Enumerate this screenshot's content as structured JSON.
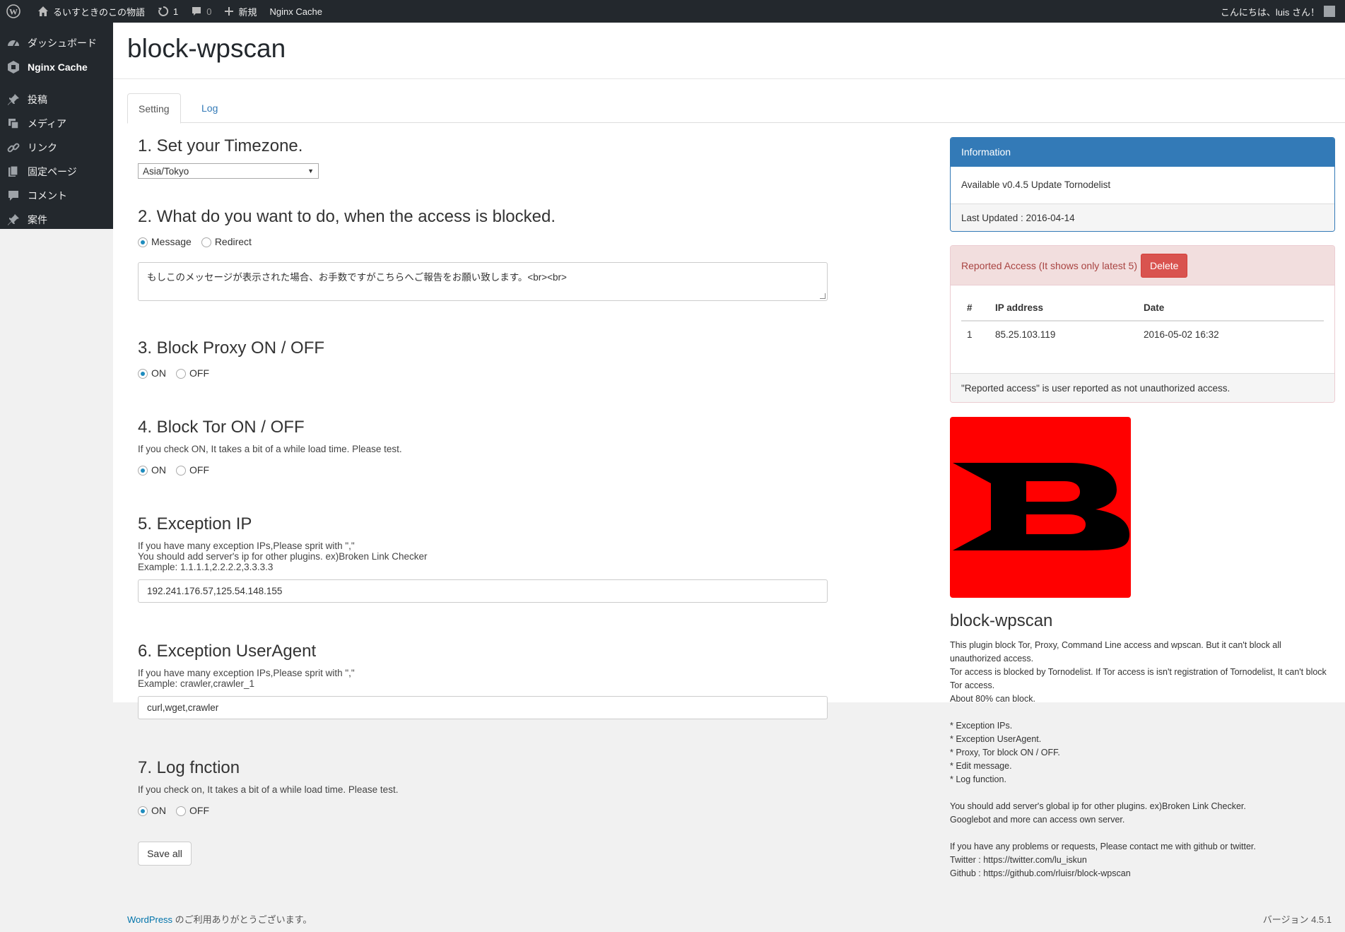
{
  "adminbar": {
    "site_name": "るいすときのこの物語",
    "updates_count": "1",
    "comments_count": "0",
    "new_label": "新規",
    "nginx_label": "Nginx Cache",
    "greeting": "こんにちは、luis さん！"
  },
  "menu": {
    "items": [
      {
        "label": "ダッシュボード",
        "icon": "dashboard-icon"
      },
      {
        "label": "Nginx Cache",
        "icon": "nginx-icon"
      },
      {
        "label": "投稿",
        "icon": "pin-icon"
      },
      {
        "label": "メディア",
        "icon": "media-icon"
      },
      {
        "label": "リンク",
        "icon": "link-icon"
      },
      {
        "label": "固定ページ",
        "icon": "page-icon"
      },
      {
        "label": "コメント",
        "icon": "comment-icon"
      },
      {
        "label": "案件",
        "icon": "pin-icon"
      }
    ]
  },
  "page": {
    "title": "block-wpscan",
    "tabs": [
      "Setting",
      "Log"
    ]
  },
  "form": {
    "s1_title": "1. Set your Timezone.",
    "timezone": "Asia/Tokyo",
    "s2_title": "2. What do you want to do, when the access is blocked.",
    "s2_options": [
      "Message",
      "Redirect"
    ],
    "message_value": "もしこのメッセージが表示された場合、お手数ですがこちらへご報告をお願い致します。<br><br>",
    "s3_title": "3. Block Proxy ON / OFF",
    "on_label": "ON",
    "off_label": "OFF",
    "s4_title": "4. Block Tor ON / OFF",
    "s4_help": "If you check ON, It takes a bit of a while load time. Please test.",
    "s5_title": "5. Exception IP",
    "s5_help1": "If you have many exception IPs,Please sprit with \",\"",
    "s5_help2": "You should add server's ip for other plugins. ex)Broken Link Checker",
    "s5_help3": "Example: 1.1.1.1,2.2.2.2,3.3.3.3",
    "exception_ip": "192.241.176.57,125.54.148.155",
    "s6_title": "6. Exception UserAgent",
    "s6_help1": "If you have many exception IPs,Please sprit with \",\"",
    "s6_help2": "Example: crawler,crawler_1",
    "exception_ua": "curl,wget,crawler",
    "s7_title": "7. Log fnction",
    "s7_help": "If you check on, It takes a bit of a while load time. Please test.",
    "save_label": "Save all"
  },
  "info": {
    "heading": "Information",
    "body": "Available v0.4.5 Update Tornodelist",
    "footer": "Last Updated : 2016-04-14"
  },
  "reported": {
    "heading": "Reported Access (It shows only latest 5)",
    "delete_label": "Delete",
    "columns": [
      "#",
      "IP address",
      "Date"
    ],
    "rows": [
      {
        "num": "1",
        "ip": "85.25.103.119",
        "date": "2016-05-02 16:32"
      }
    ],
    "footer": "\"Reported access\" is user reported as not unauthorized access."
  },
  "about": {
    "title": "block-wpscan",
    "lines": [
      "This plugin block Tor, Proxy, Command Line access and wpscan. But it can't block all unauthorized access.",
      "Tor access is blocked by Tornodelist. If Tor access is isn't registration of Tornodelist, It can't block Tor access.",
      "About 80% can block.",
      "",
      "* Exception IPs.",
      "* Exception UserAgent.",
      "* Proxy, Tor block ON / OFF.",
      "* Edit message.",
      "* Log function.",
      "",
      "You should add server's global ip for other plugins. ex)Broken Link Checker.",
      "Googlebot and more can access own server.",
      "",
      "If you have any problems or requests, Please contact me with github or twitter.",
      "Twitter : https://twitter.com/lu_iskun",
      "Github : https://github.com/rluisr/block-wpscan"
    ]
  },
  "footer": {
    "wp_link": "WordPress",
    "thanks": " のご利用ありがとうございます。",
    "version": "バージョン 4.5.1"
  },
  "colors": {
    "adminbar": "#23282d",
    "primary": "#337ab7",
    "danger": "#d9534f",
    "logo_bg": "#ff0000"
  }
}
